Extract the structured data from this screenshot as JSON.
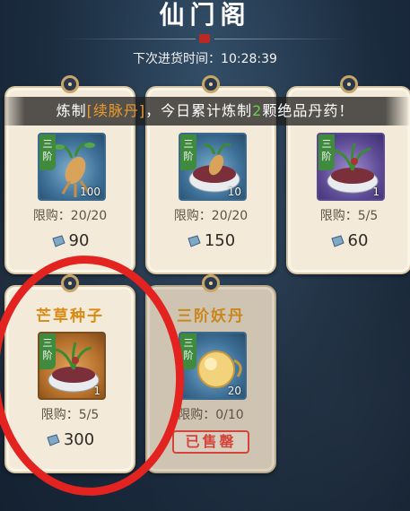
{
  "header": {
    "title": "仙门阁",
    "restock_text": "下次进货时间：10:28:39"
  },
  "banner": {
    "prefix": "炼制",
    "item": "[续脉丹]",
    "middle": "，今日累计炼制",
    "count": "2",
    "suffix": "颗绝品丹药！"
  },
  "cards": [
    {
      "name": "",
      "tier": "三阶",
      "quantity": "100",
      "limit": "限购：20/20",
      "price": "90",
      "art": "ginseng",
      "frame": "blue"
    },
    {
      "name": "",
      "tier": "三阶",
      "quantity": "10",
      "limit": "限购：20/20",
      "price": "150",
      "art": "bowl-ginseng",
      "frame": "blue"
    },
    {
      "name": "",
      "tier": "三阶",
      "quantity": "1",
      "limit": "限购：5/5",
      "price": "60",
      "art": "bowl-herb",
      "frame": "purple"
    },
    {
      "name": "芒草种子",
      "tier": "三阶",
      "quantity": "1",
      "limit": "限购：5/5",
      "price": "300",
      "art": "bowl-herb",
      "frame": "orange"
    },
    {
      "name": "三阶妖丹",
      "tier": "三阶",
      "quantity": "20",
      "limit": "限购：0/10",
      "price": "",
      "art": "golden-orb",
      "frame": "blue",
      "sold_out_label": "已售罄"
    }
  ],
  "icons": {
    "currency": "spirit-stone-icon",
    "seal": "red-seal-icon"
  },
  "colors": {
    "accent_orange": "#d98a12",
    "highlight_green": "#66d04a",
    "annotation_red": "#e3231f",
    "card_bg": "#f3ead9"
  }
}
